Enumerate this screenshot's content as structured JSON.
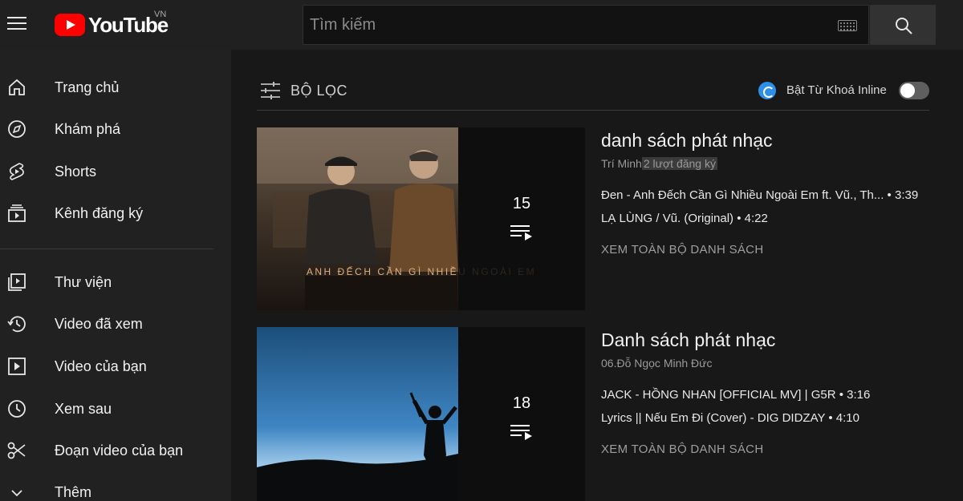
{
  "header": {
    "logo_text": "YouTube",
    "region": "VN",
    "search_placeholder": "Tìm kiếm"
  },
  "sidebar": {
    "items": [
      {
        "label": "Trang chủ",
        "icon": "home-icon"
      },
      {
        "label": "Khám phá",
        "icon": "compass-icon"
      },
      {
        "label": "Shorts",
        "icon": "shorts-icon"
      },
      {
        "label": "Kênh đăng ký",
        "icon": "subscriptions-icon"
      },
      {
        "label": "Thư viện",
        "icon": "library-icon"
      },
      {
        "label": "Video đã xem",
        "icon": "history-icon"
      },
      {
        "label": "Video của bạn",
        "icon": "your-videos-icon"
      },
      {
        "label": "Xem sau",
        "icon": "watch-later-icon"
      },
      {
        "label": "Đoạn video của bạn",
        "icon": "scissors-icon"
      },
      {
        "label": "Thêm",
        "icon": "chevron-down-icon"
      }
    ]
  },
  "filter": {
    "label": "BỘ LỌC",
    "inline_label": "Bật Từ Khoá Inline"
  },
  "playlists": [
    {
      "title": "danh sách phát nhạc",
      "channel": "Trí Minh",
      "subscribers": "2 lượt đăng ký",
      "count": "15",
      "thumb_text": "ANH ĐẾCH CẦN GÌ NHIỀU NGOÀI EM",
      "items": [
        "Đen - Anh Đếch Cần Gì Nhiều Ngoài Em ft. Vũ., Th... • 3:39",
        "LẠ LÙNG / Vũ. (Original) • 4:22"
      ],
      "view_all": "XEM TOÀN BỘ DANH SÁCH"
    },
    {
      "title": "Danh sách phát nhạc",
      "channel": "06.Đỗ Ngọc Minh Đức",
      "subscribers": "",
      "count": "18",
      "items": [
        "JACK - HỒNG NHAN [OFFICIAL MV] | G5R • 3:16",
        "Lyrics || Nếu Em Đi (Cover) - DIG DIDZAY • 4:10"
      ],
      "view_all": "XEM TOÀN BỘ DANH SÁCH"
    }
  ]
}
